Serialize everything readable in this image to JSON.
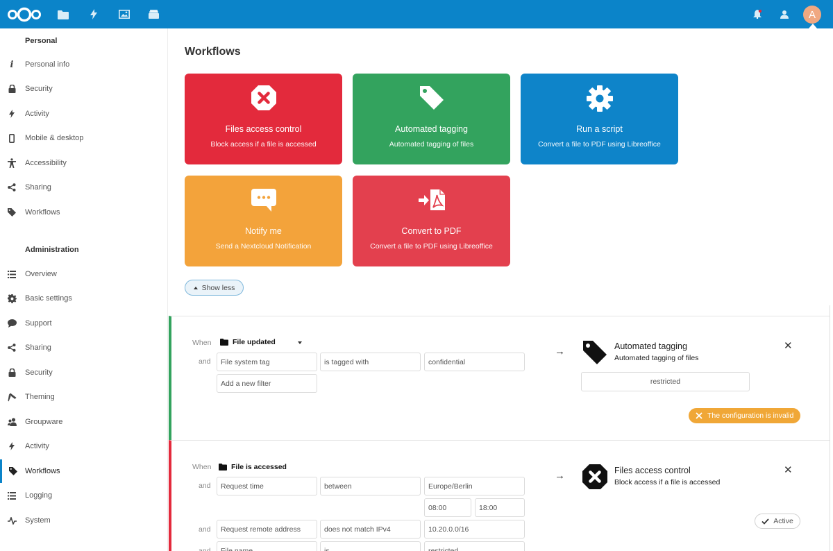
{
  "topbar": {
    "apps": [
      {
        "icon": "files-folder-icon"
      },
      {
        "icon": "activity-lightning-icon"
      },
      {
        "icon": "photos-image-icon"
      },
      {
        "icon": "deck-stack-icon"
      }
    ],
    "avatar_initial": "A",
    "brand_color": "#0b84c9"
  },
  "sidebar": {
    "personal_title": "Personal",
    "personal_items": [
      {
        "label": "Personal info",
        "icon": "info-icon"
      },
      {
        "label": "Security",
        "icon": "lock-icon"
      },
      {
        "label": "Activity",
        "icon": "lightning-icon"
      },
      {
        "label": "Mobile & desktop",
        "icon": "phone-icon"
      },
      {
        "label": "Accessibility",
        "icon": "person-icon"
      },
      {
        "label": "Sharing",
        "icon": "share-icon"
      },
      {
        "label": "Workflows",
        "icon": "tag-icon"
      }
    ],
    "admin_title": "Administration",
    "admin_items": [
      {
        "label": "Overview",
        "icon": "list-icon"
      },
      {
        "label": "Basic settings",
        "icon": "gear-icon"
      },
      {
        "label": "Support",
        "icon": "speech-bubble-icon"
      },
      {
        "label": "Sharing",
        "icon": "share-icon"
      },
      {
        "label": "Security",
        "icon": "lock-icon"
      },
      {
        "label": "Theming",
        "icon": "paint-icon"
      },
      {
        "label": "Groupware",
        "icon": "group-icon"
      },
      {
        "label": "Activity",
        "icon": "lightning-icon"
      },
      {
        "label": "Workflows",
        "icon": "tag-icon",
        "active": true
      },
      {
        "label": "Logging",
        "icon": "list-icon"
      },
      {
        "label": "System",
        "icon": "pulse-icon"
      }
    ]
  },
  "main": {
    "title": "Workflows",
    "cards": [
      {
        "title": "Files access control",
        "subtitle": "Block access if a file is accessed",
        "color": "#e32a3c",
        "icon": "block-x-icon"
      },
      {
        "title": "Automated tagging",
        "subtitle": "Automated tagging of files",
        "color": "#33a35e",
        "icon": "tag-icon"
      },
      {
        "title": "Run a script",
        "subtitle": "Convert a file to PDF using Libreoffice",
        "color": "#0e84c9",
        "icon": "gear-icon"
      },
      {
        "title": "Notify me",
        "subtitle": "Send a Nextcloud Notification",
        "color": "#f3a33b",
        "icon": "notification-bubble-icon"
      },
      {
        "title": "Convert to PDF",
        "subtitle": "Convert a file to PDF using Libreoffice",
        "color": "#e3404e",
        "icon": "pdf-convert-icon"
      }
    ],
    "show_less_label": "Show less",
    "rules": [
      {
        "accent": "#33a35e",
        "when_label": "When",
        "event": "File updated",
        "and_label": "and",
        "checks": [
          {
            "field": "File system tag",
            "operator": "is tagged with",
            "value": "confidential"
          }
        ],
        "add_filter_placeholder": "Add a new filter",
        "operation_title": "Automated tagging",
        "operation_subtitle": "Automated tagging of files",
        "operation_value": "restricted",
        "status": "The configuration is invalid"
      },
      {
        "accent": "#e32a3c",
        "when_label": "When",
        "event": "File is accessed",
        "and_label": "and",
        "checks": [
          {
            "field": "Request time",
            "operator": "between",
            "value": "Europe/Berlin",
            "time_from": "08:00",
            "time_to": "18:00"
          },
          {
            "field": "Request remote address",
            "operator": "does not match IPv4",
            "value": "10.20.0.0/16"
          },
          {
            "field": "File name",
            "operator": "is",
            "value": "restricted"
          }
        ],
        "operation_title": "Files access control",
        "operation_subtitle": "Block access if a file is accessed",
        "status": "Active"
      }
    ]
  }
}
